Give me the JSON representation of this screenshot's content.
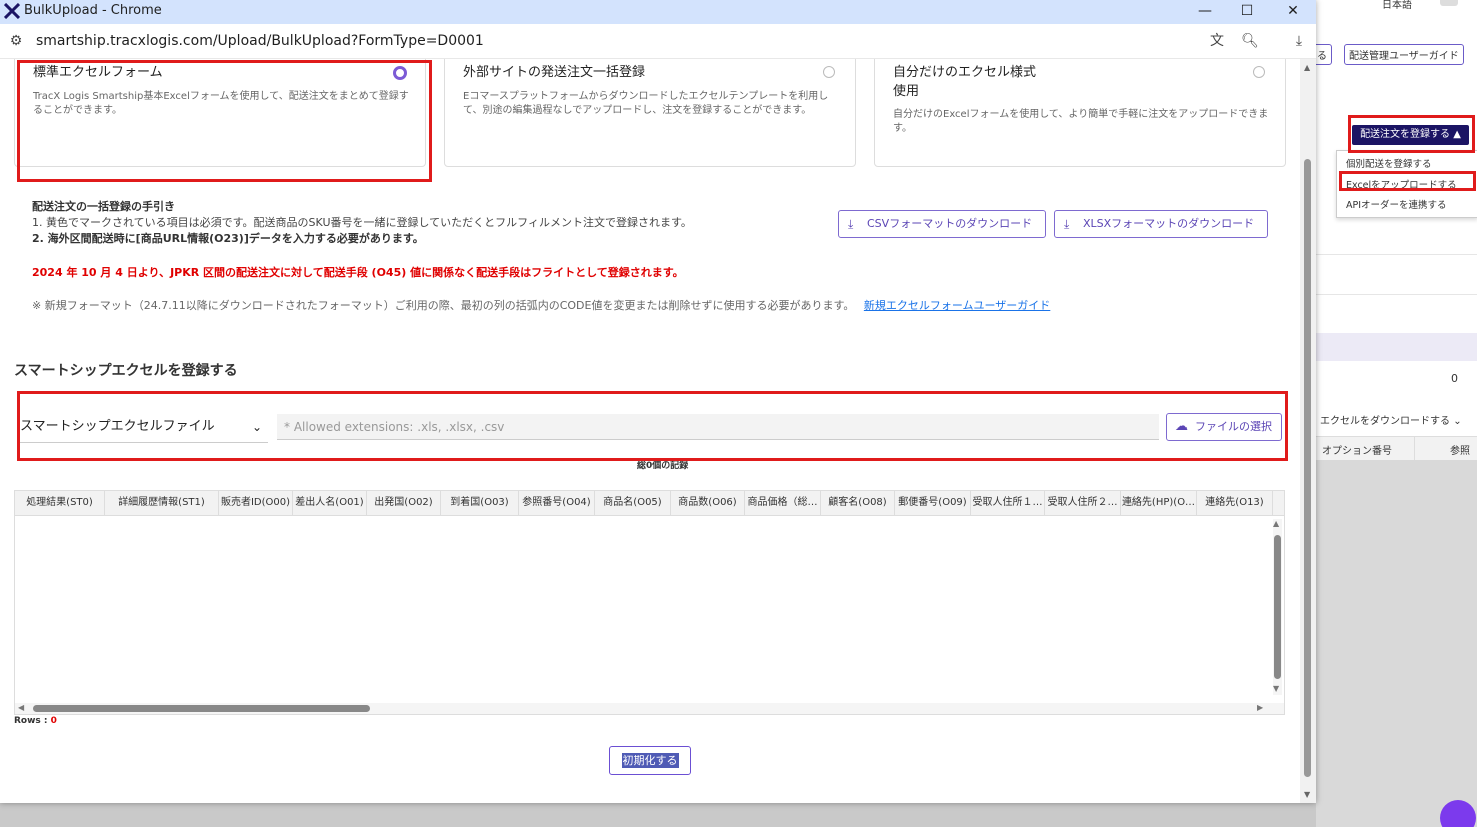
{
  "window": {
    "title": "BulkUpload - Chrome",
    "url": "smartship.tracxlogis.com/Upload/BulkUpload?FormType=D0001",
    "controls": {
      "minimize": "—",
      "maximize": "☐",
      "close": "✕"
    }
  },
  "form_cards": [
    {
      "title": "標準エクセルフォーム",
      "desc": "TracX Logis Smartship基本Excelフォームを使用して、配送注文をまとめて登録することができます。",
      "selected": true
    },
    {
      "title": "外部サイトの発送注文一括登録",
      "desc": "Eコマースプラットフォームからダウンロードしたエクセルテンプレートを利用して、別途の編集過程なしでアップロードし、注文を登録することができます。",
      "selected": false
    },
    {
      "title": "自分だけのエクセル様式\n使用",
      "desc": "自分だけのExcelフォームを使用して、より簡単で手軽に注文をアップロードできます。",
      "selected": false
    }
  ],
  "guide": {
    "heading": "配送注文の一括登録の手引き",
    "line1": "1. 黄色でマークされている項目は必須です。配送商品のSKU番号を一緒に登録していただくとフルフィルメント注文で登録されます。",
    "line2": "2. 海外区間配送時に[商品URL情報(O23)]データを入力する必要があります。",
    "warning": "2024 年 10 月 4 日より、JPKR 区間の配送注文に対して配送手段 (O45) 値に関係なく配送手段はフライトとして登録されます。",
    "note": "※ 新規フォーマット（24.7.11以降にダウンロードされたフォーマット）ご利用の際、最初の列の括弧内のCODE値を変更または削除せずに使用する必要があります。",
    "note_link": "新規エクセルフォームユーザーガイド"
  },
  "downloads": {
    "csv": "CSVフォーマットのダウンロード",
    "xlsx": "XLSXフォーマットのダウンロード"
  },
  "upload": {
    "section_title": "スマートシップエクセルを登録する",
    "file_type": "スマートシップエクセルファイル",
    "placeholder": "* Allowed extensions: .xls, .xlsx, .csv",
    "choose_button": "ファイルの選択",
    "total": "総0個の記録"
  },
  "grid": {
    "columns": [
      "処理結果(ST0)",
      "詳細履歴情報(ST1)",
      "販売者ID(O00)",
      "差出人名(O01)",
      "出発国(O02)",
      "到着国(O03)",
      "参照番号(O04)",
      "商品名(O05)",
      "商品数(O06)",
      "商品価格（総…",
      "顧客名(O08)",
      "郵便番号(O09)",
      "受取人住所１…",
      "受取人住所２…",
      "連絡先(HP)(O…",
      "連絡先(O13)"
    ],
    "rows_label": "Rows :",
    "rows_count": "0"
  },
  "reset_button": "初期化する",
  "background_app": {
    "top_lang": "日本語",
    "btn_partial": "る",
    "btn_guide": "配送管理ユーザーガイド",
    "register_button": "配送注文を登録する ▲",
    "menu": [
      "個別配送を登録する",
      "Excelをアップロードする",
      "APIオーダーを連携する"
    ],
    "count": "0",
    "download_excel": "エクセルをダウンロードする",
    "col_option": "オプション番号",
    "col_ref": "参照"
  },
  "colors": {
    "accent": "#6b4fd3",
    "highlight_red": "#e01b1b",
    "warning_text": "#e00000",
    "link": "#1a73e8",
    "title_bar": "#d3e3fd"
  }
}
